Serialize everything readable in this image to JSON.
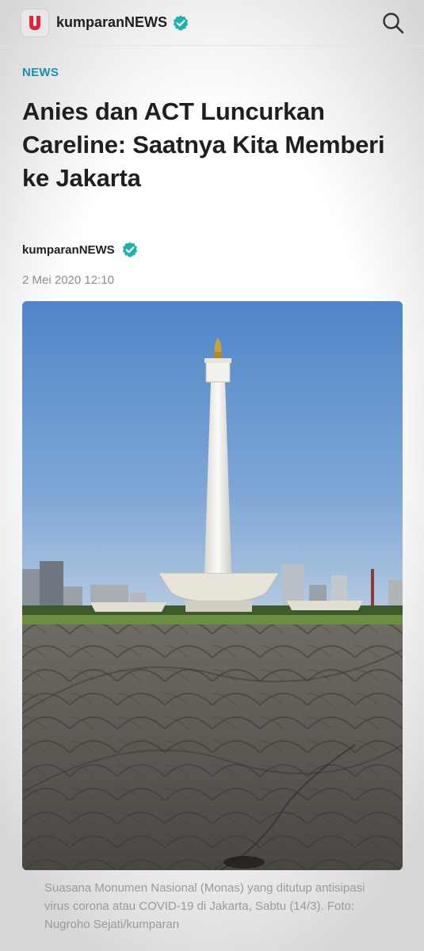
{
  "app": {
    "brand_name": "kumparanNEWS",
    "logo_letter": "U",
    "accent_color": "#1d8fa8",
    "logo_color": "#e0243b",
    "verified_color": "#1fb0b0"
  },
  "header": {
    "search_icon": "search-icon"
  },
  "article": {
    "category": "NEWS",
    "title": "Anies dan ACT Luncurkan Careline: Saatnya Kita Memberi ke Jakarta",
    "author": "kumparanNEWS",
    "date": "2 Mei 2020 12:10",
    "caption": "Suasana Monumen Nasional (Monas) yang ditutup antisipasi virus corona atau COVID-19 di Jakarta, Sabtu (14/3). Foto: Nugroho Sejati/kumparan"
  }
}
